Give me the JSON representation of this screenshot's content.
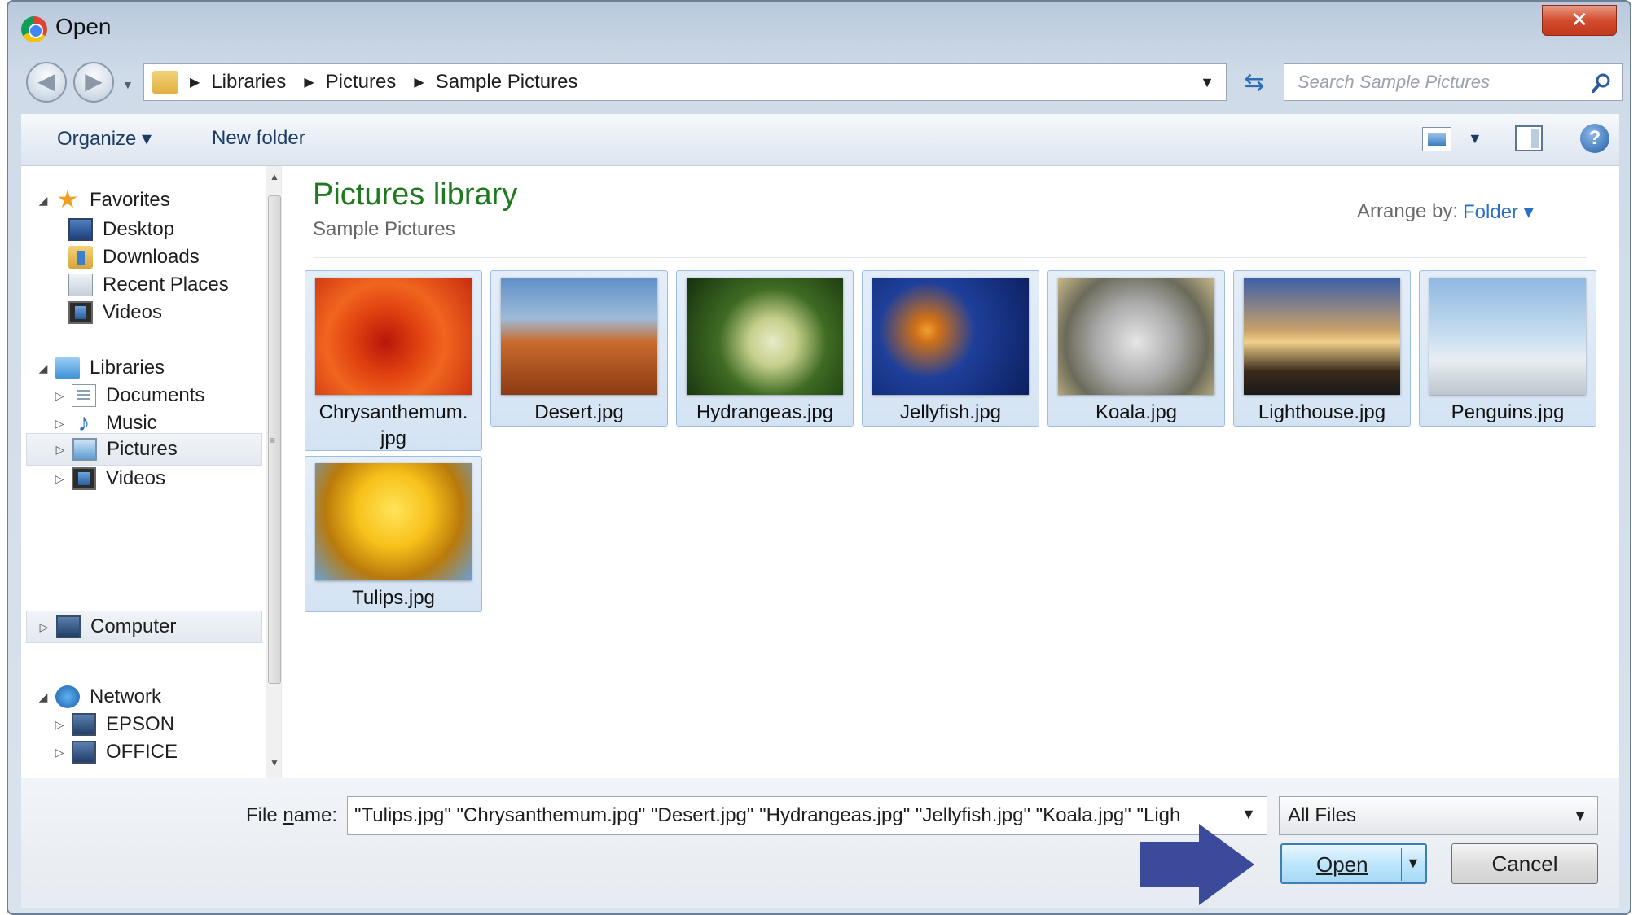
{
  "window": {
    "title": "Open",
    "close_glyph": "✕"
  },
  "address": {
    "breadcrumbs": [
      "Libraries",
      "Pictures",
      "Sample Pictures"
    ],
    "search_placeholder": "Search Sample Pictures"
  },
  "toolbar": {
    "organize": "Organize ▾",
    "new_folder": "New folder",
    "help": "?"
  },
  "nav": {
    "items": [
      {
        "label": "Favorites",
        "icon": "star-icon",
        "expander": "◢"
      },
      {
        "label": "Desktop",
        "icon": "desktop-icon"
      },
      {
        "label": "Downloads",
        "icon": "downloads-folder-icon"
      },
      {
        "label": "Recent Places",
        "icon": "recent-places-icon"
      },
      {
        "label": "Videos",
        "icon": "videos-icon"
      },
      {
        "label": "Libraries",
        "icon": "libraries-icon",
        "expander": "◢"
      },
      {
        "label": "Documents",
        "icon": "documents-icon",
        "expander": "▷"
      },
      {
        "label": "Music",
        "icon": "music-icon",
        "expander": "▷"
      },
      {
        "label": "Pictures",
        "icon": "pictures-icon",
        "expander": "▷",
        "selected": true
      },
      {
        "label": "Videos",
        "icon": "videos-icon",
        "expander": "▷"
      },
      {
        "label": "Computer",
        "icon": "computer-icon",
        "expander": "▷"
      },
      {
        "label": "Network",
        "icon": "network-icon",
        "expander": "◢"
      },
      {
        "label": "EPSON",
        "icon": "computer-icon",
        "expander": "▷"
      },
      {
        "label": "OFFICE",
        "icon": "computer-icon",
        "expander": "▷"
      }
    ]
  },
  "library": {
    "title": "Pictures library",
    "subtitle": "Sample Pictures",
    "arrange_label": "Arrange by:",
    "arrange_value": "Folder ▾"
  },
  "files": [
    {
      "name": "Chrysanthemum.\njpg"
    },
    {
      "name": "Desert.jpg"
    },
    {
      "name": "Hydrangeas.jpg"
    },
    {
      "name": "Jellyfish.jpg"
    },
    {
      "name": "Koala.jpg"
    },
    {
      "name": "Lighthouse.jpg"
    },
    {
      "name": "Penguins.jpg"
    },
    {
      "name": "Tulips.jpg"
    }
  ],
  "footer": {
    "filename_label_pre": "File ",
    "filename_label_u": "n",
    "filename_label_post": "ame:",
    "filename_value": "\"Tulips.jpg\" \"Chrysanthemum.jpg\" \"Desert.jpg\" \"Hydrangeas.jpg\" \"Jellyfish.jpg\" \"Koala.jpg\" \"Ligh",
    "filetype_value": "All Files",
    "open_label": "Open",
    "cancel_label": "Cancel"
  },
  "colors": {
    "library_title": "#1f7a1f",
    "link_blue": "#2a6fc4",
    "pointer_arrow": "#3b4a9a"
  }
}
